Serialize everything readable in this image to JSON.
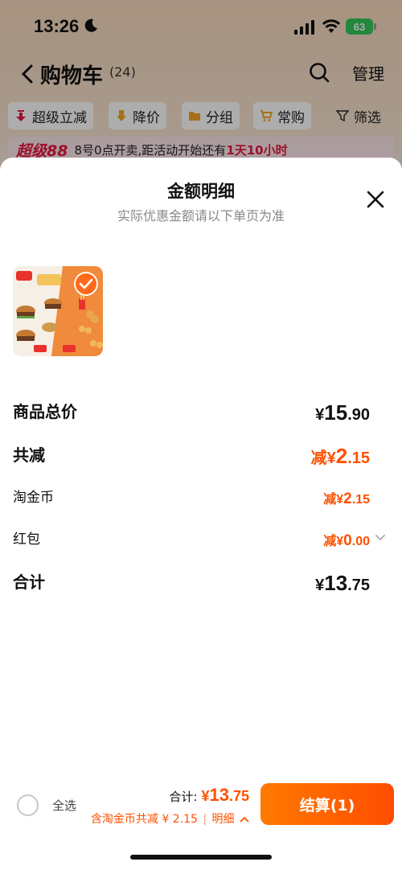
{
  "status_bar": {
    "time": "13:26",
    "battery": "63"
  },
  "nav": {
    "title": "购物车",
    "count": "(24)",
    "manage_label": "管理"
  },
  "filters": {
    "items": [
      {
        "label": "超级立减",
        "icon": "arrow-down-red-icon"
      },
      {
        "label": "降价",
        "icon": "arrow-down-orange-icon"
      },
      {
        "label": "分组",
        "icon": "folder-icon"
      },
      {
        "label": "常购",
        "icon": "cart-plus-icon"
      },
      {
        "label": "筛选",
        "icon": "filter-icon"
      }
    ]
  },
  "promo": {
    "logo": "超级88",
    "text": "8号0点开卖,距活动开始还有",
    "highlight": "1天10小时"
  },
  "sheet": {
    "title": "金额明细",
    "subtitle": "实际优惠金额请以下单页为准",
    "rows": {
      "subtotal": {
        "label": "商品总价",
        "currency": "¥",
        "int": "15",
        "dec": ".90"
      },
      "total_discount": {
        "label": "共减",
        "prefix": "减¥",
        "int": "2",
        "dec": ".15"
      },
      "taojinbi": {
        "label": "淘金币",
        "prefix": "减¥",
        "int": "2",
        "dec": ".15"
      },
      "hongbao": {
        "label": "红包",
        "prefix": "减¥",
        "int": "0",
        "dec": ".00"
      },
      "total": {
        "label": "合计",
        "currency": "¥",
        "int": "13",
        "dec": ".75"
      }
    }
  },
  "bottom_bar": {
    "select_all": "全选",
    "total_label": "合计:",
    "total_currency": "¥",
    "total_int": "13",
    "total_dec": ".75",
    "discount_text": "含淘金币共减 ¥ 2.15",
    "separator": "|",
    "detail_label": "明细",
    "checkout_label": "结算(1)"
  },
  "colors": {
    "accent": "#ff5000",
    "promo_red": "#e8193f"
  }
}
